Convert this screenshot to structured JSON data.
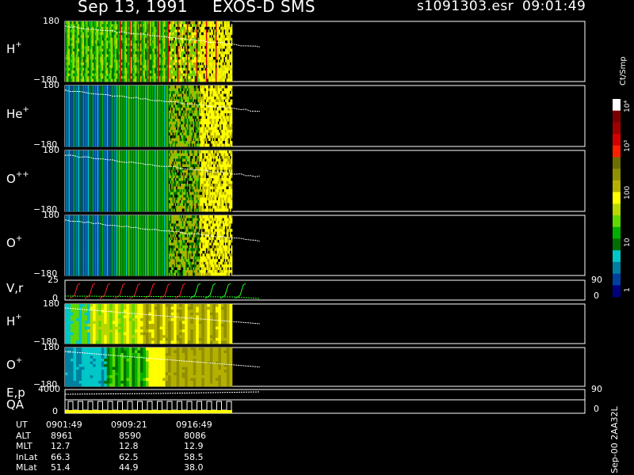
{
  "header": {
    "date": "Sep 13, 1991",
    "instrument": "EXOS-D SMS",
    "file": "s1091303.esr",
    "time": "09:01:49"
  },
  "panels": [
    {
      "label": "H",
      "sup": "+",
      "ytop": "180",
      "ybot": "−180",
      "style": "ion-hi"
    },
    {
      "label": "He",
      "sup": "+",
      "ytop": "180",
      "ybot": "−180",
      "style": "ion-lo"
    },
    {
      "label": "O",
      "sup": "++",
      "ytop": "180",
      "ybot": "−180",
      "style": "ion-lo"
    },
    {
      "label": "O",
      "sup": "+",
      "ytop": "180",
      "ybot": "−180",
      "style": "ion-lo"
    },
    {
      "label": "V,r",
      "sup": "",
      "ytop": "25",
      "ybot": "0",
      "rtop": "90",
      "rbot": "0",
      "style": "lines"
    },
    {
      "label": "H",
      "sup": "+",
      "ytop": "180",
      "ybot": "−180",
      "style": "pitch-h"
    },
    {
      "label": "O",
      "sup": "+",
      "ytop": "180",
      "ybot": "−180",
      "style": "pitch-o"
    },
    {
      "label": "E,p",
      "sup": "",
      "ytop": "4000",
      "ybot": "",
      "rtop": "90",
      "rbot": "",
      "style": "ep"
    },
    {
      "label": "QA",
      "sup": "",
      "ytop": "",
      "ybot": "0",
      "rtop": "",
      "rbot": "0",
      "style": "qa"
    }
  ],
  "colorbar": {
    "unit": "Ct/Smp",
    "labels": [
      "10⁴",
      "10³",
      "100",
      "10",
      "1"
    ],
    "colors": [
      "#ffffff",
      "#7a0000",
      "#a00000",
      "#d40000",
      "#ff2000",
      "#6e6e00",
      "#909000",
      "#b5b000",
      "#ffff00",
      "#b8d800",
      "#60d800",
      "#00b000",
      "#007000",
      "#00c8c8",
      "#0080a0",
      "#0040a0",
      "#000080"
    ]
  },
  "footer": {
    "rows": [
      {
        "name": "UT",
        "values": [
          "0901:49",
          "0909:21",
          "0916:49"
        ]
      },
      {
        "name": "ALT",
        "values": [
          "8961",
          "8590",
          "8086"
        ]
      },
      {
        "name": "MLT",
        "values": [
          "12.7",
          "12.8",
          "12.9"
        ]
      },
      {
        "name": "InLat",
        "values": [
          "66.3",
          "62.5",
          "58.5"
        ]
      },
      {
        "name": "MLat",
        "values": [
          "51.4",
          "44.9",
          "38.0"
        ]
      }
    ],
    "side_label": "Sep-00 2AA32L"
  },
  "chart_data": {
    "type": "heatmap",
    "title": "Sep 13, 1991   EXOS-D SMS",
    "x_ticks": [
      "0901:49",
      "0909:21",
      "0916:49"
    ],
    "series": [
      {
        "name": "H+",
        "ylim": [
          -180,
          180
        ]
      },
      {
        "name": "He+",
        "ylim": [
          -180,
          180
        ]
      },
      {
        "name": "O++",
        "ylim": [
          -180,
          180
        ]
      },
      {
        "name": "O+",
        "ylim": [
          -180,
          180
        ]
      },
      {
        "name": "V,r",
        "ylim": [
          0,
          25
        ],
        "right_ylim": [
          0,
          90
        ]
      },
      {
        "name": "H+",
        "ylim": [
          -180,
          180
        ]
      },
      {
        "name": "O+",
        "ylim": [
          -180,
          180
        ]
      },
      {
        "name": "E,p",
        "ylim": [
          0,
          4000
        ],
        "right_ylim": [
          0,
          90
        ]
      },
      {
        "name": "QA",
        "ylim": [
          0,
          1
        ]
      }
    ],
    "colorbar": {
      "label": "Ct/Smp",
      "scale": "log",
      "range": [
        1,
        10000
      ]
    }
  }
}
